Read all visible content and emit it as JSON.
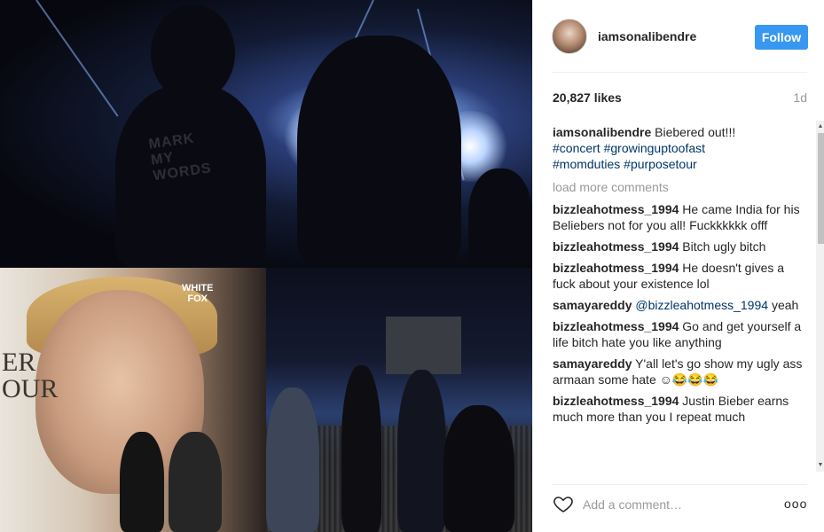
{
  "post": {
    "photo_overlay": {
      "shirt_text": "MARK\nMY\nWORDS",
      "poster_text": "ER\nOUR",
      "logo_text": "WHITE\nFOX"
    }
  },
  "header": {
    "username": "iamsonalibendre",
    "follow_label": "Follow"
  },
  "stats": {
    "likes": "20,827 likes",
    "time": "1d"
  },
  "caption": {
    "user": "iamsonalibendre",
    "text": "Biebered out!!!",
    "tags": [
      "#concert",
      "#growinguptoofast",
      "#momduties",
      "#purposetour"
    ]
  },
  "load_more": "load more comments",
  "comments": [
    {
      "user": "bizzleahotmess_1994",
      "text": "He came India for his Beliebers not for you all! Fuckkkkkk offf"
    },
    {
      "user": "bizzleahotmess_1994",
      "text": "Bitch ugly bitch"
    },
    {
      "user": "bizzleahotmess_1994",
      "text": "He doesn't gives a fuck about your existence lol"
    },
    {
      "user": "samayareddy",
      "mention": "@bizzleahotmess_1994",
      "text": "yeah"
    },
    {
      "user": "bizzleahotmess_1994",
      "text": "Go and get yourself a life bitch hate you like anything"
    },
    {
      "user": "samayareddy",
      "text": "Y'all let's go show my ugly ass armaan some hate ☺😂😂😂"
    },
    {
      "user": "bizzleahotmess_1994",
      "text": "Justin Bieber earns much more than you I repeat much"
    }
  ],
  "footer": {
    "comment_placeholder": "Add a comment…",
    "more_label": "ooo"
  },
  "icons": {
    "heart": "heart-icon",
    "more": "more-options-icon"
  },
  "colors": {
    "follow_button": "#3897f0",
    "hashtag": "#003569",
    "muted": "#999999"
  }
}
